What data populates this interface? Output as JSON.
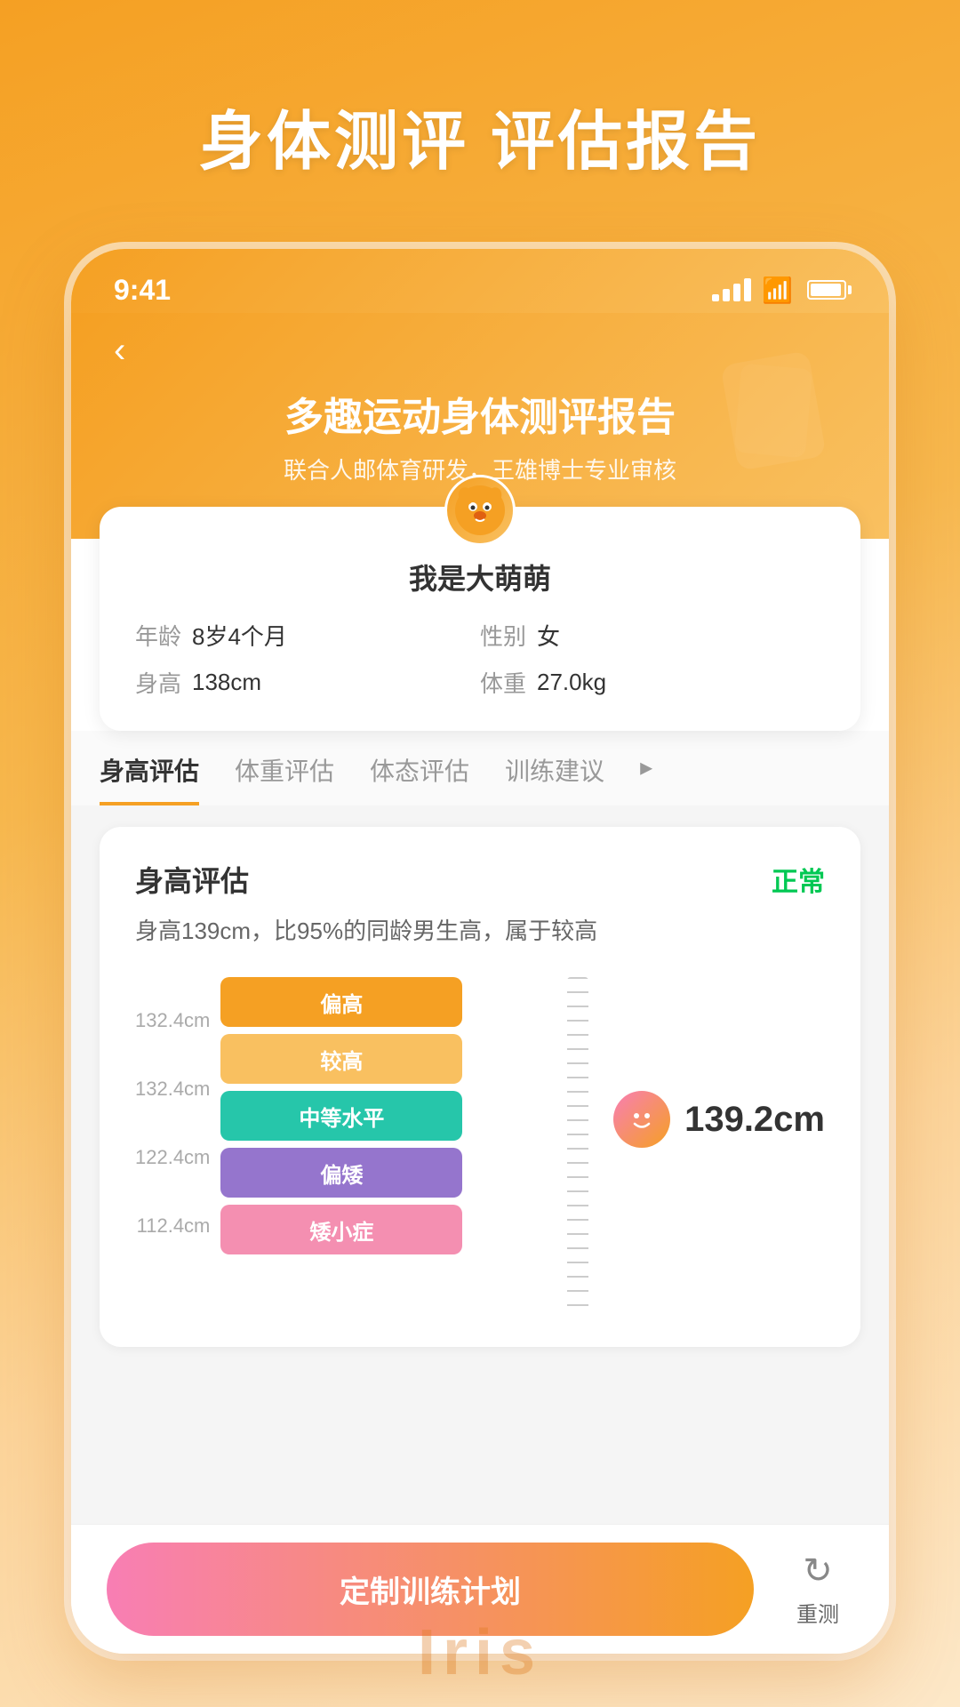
{
  "page": {
    "title": "身体测评 评估报告",
    "background_color": "#f5a023"
  },
  "status_bar": {
    "time": "9:41",
    "signal_label": "signal",
    "wifi_label": "wifi",
    "battery_label": "battery"
  },
  "header": {
    "back_label": "‹",
    "report_title": "多趣运动身体测评报告",
    "report_subtitle": "联合人邮体育研发，王雄博士专业审核"
  },
  "profile": {
    "name": "我是大萌萌",
    "avatar_emoji": "🐱",
    "age_label": "年龄",
    "age_value": "8岁4个月",
    "gender_label": "性别",
    "gender_value": "女",
    "height_label": "身高",
    "height_value": "138cm",
    "weight_label": "体重",
    "weight_value": "27.0kg"
  },
  "tabs": [
    {
      "id": "height",
      "label": "身高评估",
      "active": true
    },
    {
      "id": "weight",
      "label": "体重评估",
      "active": false
    },
    {
      "id": "posture",
      "label": "体态评估",
      "active": false
    },
    {
      "id": "training",
      "label": "训练建议",
      "active": false
    },
    {
      "id": "more",
      "label": "▸",
      "active": false
    }
  ],
  "assessment": {
    "title": "身高评估",
    "status": "正常",
    "status_color": "#00c853",
    "description": "身高139cm，比95%的同龄男生高，属于较高",
    "height_indicator": "139.2cm",
    "smiley_emoji": "☺",
    "bars": [
      {
        "label": "偏高",
        "color": "bar-orange-dark",
        "width": "75%"
      },
      {
        "label": "较高",
        "color": "bar-orange-light",
        "width": "75%"
      },
      {
        "label": "中等水平",
        "color": "bar-teal",
        "width": "75%"
      },
      {
        "label": "偏矮",
        "color": "bar-purple",
        "width": "75%"
      },
      {
        "label": "矮小症",
        "color": "bar-pink",
        "width": "75%"
      }
    ],
    "scale_labels": [
      "132.4cm",
      "132.4cm",
      "122.4cm",
      "112.4cm"
    ]
  },
  "bottom": {
    "primary_btn_label": "定制训练计划",
    "refresh_icon": "↻",
    "refresh_label": "重测"
  },
  "branding": {
    "name": "Iris"
  }
}
